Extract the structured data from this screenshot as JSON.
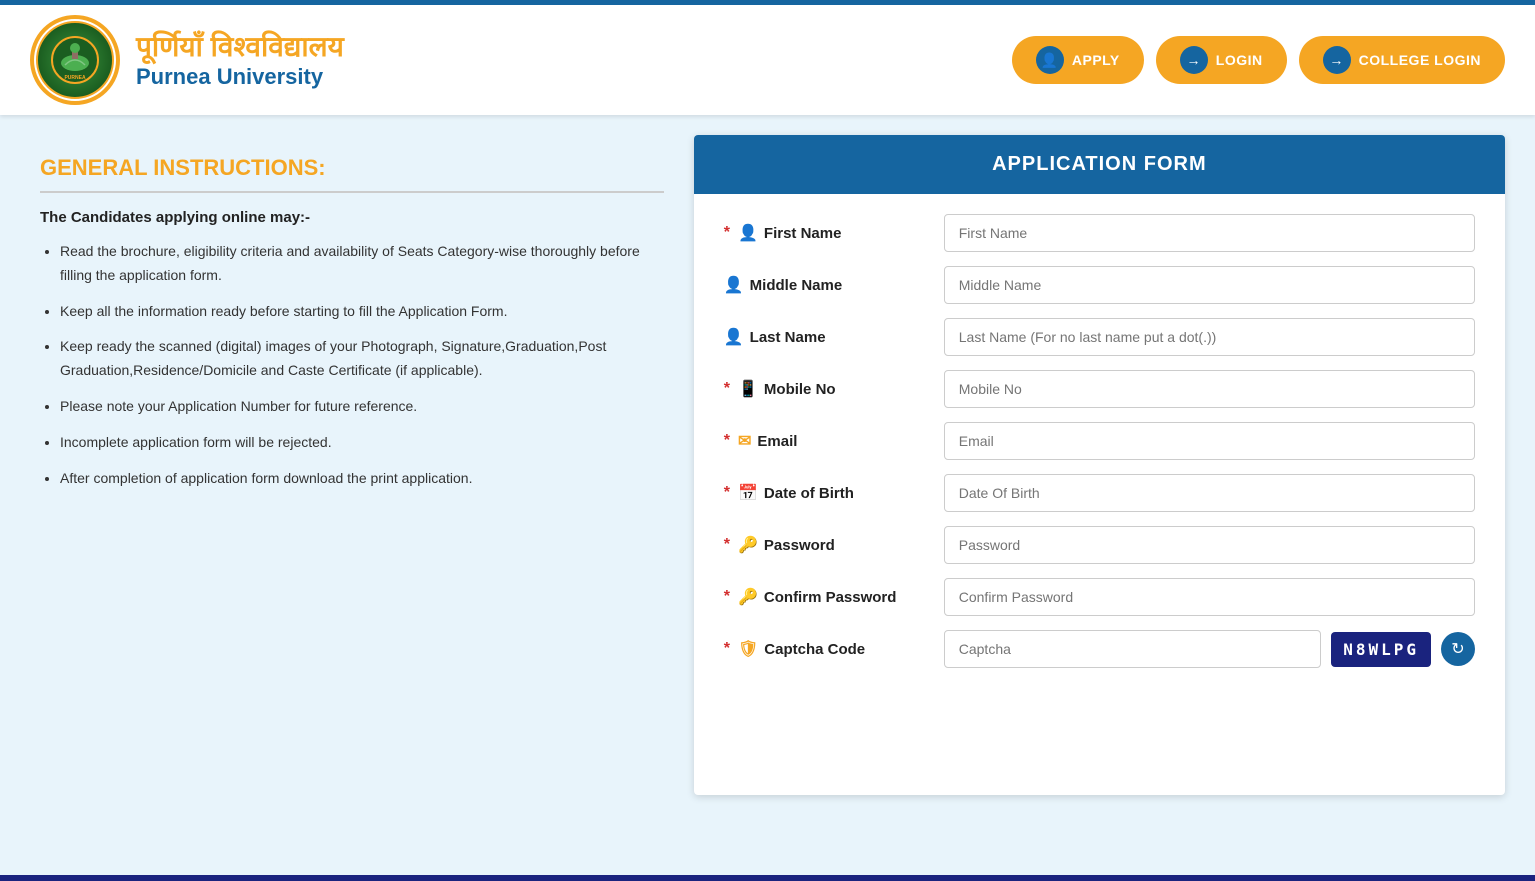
{
  "header": {
    "university_name_hindi": "पूर्णियाँ विश्वविद्यालय",
    "university_name_english": "Purnea University",
    "apply_btn": "APPLY",
    "login_btn": "LOGIN",
    "college_login_btn": "COLLEGE LOGIN"
  },
  "instructions": {
    "title": "GENERAL INSTRUCTIONS:",
    "subtitle": "The Candidates applying online may:-",
    "items": [
      "Read the brochure, eligibility criteria and availability of Seats Category-wise thoroughly before filling the application form.",
      "Keep all the information ready before starting to fill the Application Form.",
      "Keep ready the scanned (digital) images of your Photograph, Signature,Graduation,Post Graduation,Residence/Domicile and Caste Certificate (if applicable).",
      "Please note your Application Number for future reference.",
      "Incomplete application form will be rejected.",
      "After completion of application form download the print application."
    ]
  },
  "form": {
    "title": "APPLICATION FORM",
    "fields": [
      {
        "label": "First Name",
        "placeholder": "First Name",
        "required": true,
        "icon": "person",
        "type": "text"
      },
      {
        "label": "Middle Name",
        "placeholder": "Middle Name",
        "required": false,
        "icon": "person",
        "type": "text"
      },
      {
        "label": "Last Name",
        "placeholder": "Last Name (For no last name put a dot(.))",
        "required": false,
        "icon": "person",
        "type": "text"
      },
      {
        "label": "Mobile No",
        "placeholder": "Mobile No",
        "required": true,
        "icon": "phone",
        "type": "text"
      },
      {
        "label": "Email",
        "placeholder": "Email",
        "required": true,
        "icon": "email",
        "type": "text"
      },
      {
        "label": "Date of Birth",
        "placeholder": "Date Of Birth",
        "required": true,
        "icon": "calendar",
        "type": "text"
      },
      {
        "label": "Password",
        "placeholder": "Password",
        "required": true,
        "icon": "key",
        "type": "password"
      },
      {
        "label": "Confirm Password",
        "placeholder": "Confirm Password",
        "required": true,
        "icon": "key",
        "type": "password"
      },
      {
        "label": "Captcha Code",
        "placeholder": "Captcha",
        "required": true,
        "icon": "shield",
        "type": "text"
      }
    ],
    "captcha_value": "N8WLPG"
  }
}
